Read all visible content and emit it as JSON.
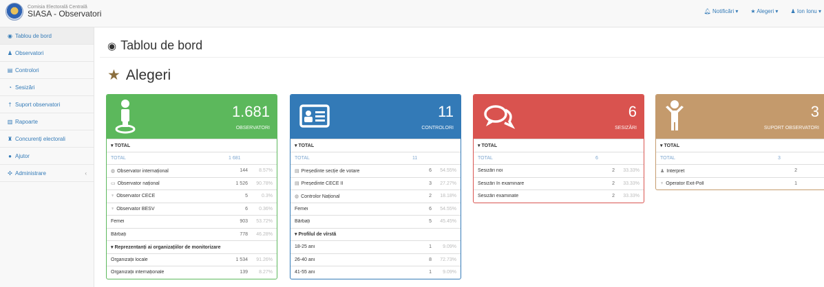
{
  "brand": {
    "sub": "Comisia Electorală Centrală",
    "main": "SIASA - Observatori"
  },
  "topnav": [
    {
      "label": "Notificări ▾",
      "icon": "bell-icon"
    },
    {
      "label": "★ Alegeri ▾",
      "icon": "star-icon"
    },
    {
      "label": "Ion Ionu ▾",
      "icon": "user-icon"
    }
  ],
  "sidebar": [
    {
      "label": "Tablou de bord",
      "glyph": "◉"
    },
    {
      "label": "Observatori",
      "glyph": "♟"
    },
    {
      "label": "Controlori",
      "glyph": "▤"
    },
    {
      "label": "Sesizări",
      "glyph": "◔"
    },
    {
      "label": "Suport observatori",
      "glyph": "†"
    },
    {
      "label": "Rapoarte",
      "glyph": "▥"
    },
    {
      "label": "Concurenți electorali",
      "glyph": "♜"
    },
    {
      "label": "Ajutor",
      "glyph": "●"
    },
    {
      "label": "Administrare",
      "glyph": "✣",
      "arrow": "‹"
    }
  ],
  "page_title": "Tablou de bord",
  "section_title": "Alegeri",
  "colors": {
    "green": "#5cb85c",
    "blue": "#337ab7",
    "red": "#d9534f",
    "tan": "#c49a6c"
  },
  "panels": {
    "observatori": {
      "count": "1.681",
      "label": "OBSERVATORI",
      "rows": [
        {
          "type": "hdr",
          "label": "▾ TOTAL"
        },
        {
          "type": "total",
          "label": "TOTAL",
          "n": "1 681",
          "p": ""
        },
        {
          "label": "Observator internațional",
          "glyph": "◍",
          "n": "144",
          "p": "8.57%"
        },
        {
          "label": "Observator național",
          "glyph": "▭",
          "n": "1 526",
          "p": "90.78%"
        },
        {
          "label": "Observator CECE",
          "glyph": "♆",
          "n": "5",
          "p": "0.3%"
        },
        {
          "label": "Observator BESV",
          "glyph": "♆",
          "n": "6",
          "p": "0.36%"
        },
        {
          "label": "Femei",
          "n": "903",
          "p": "53.72%"
        },
        {
          "label": "Bărbați",
          "n": "778",
          "p": "46.28%"
        },
        {
          "type": "hdr",
          "label": "▾ Reprezentanți ai organizațiilor de monitorizare"
        },
        {
          "label": "Organizații locale",
          "n": "1 534",
          "p": "91.26%"
        },
        {
          "label": "Organizații internaționale",
          "n": "139",
          "p": "8.27%"
        }
      ]
    },
    "controlori": {
      "count": "11",
      "label": "CONTROLORI",
      "rows": [
        {
          "type": "hdr",
          "label": "▾ TOTAL"
        },
        {
          "type": "total",
          "label": "TOTAL",
          "n": "11",
          "p": ""
        },
        {
          "label": "Președinte secție de votare",
          "glyph": "▤",
          "n": "6",
          "p": "54.55%"
        },
        {
          "label": "Președinte CECE II",
          "glyph": "▤",
          "n": "3",
          "p": "27.27%"
        },
        {
          "label": "Controlor Național",
          "glyph": "◍",
          "n": "2",
          "p": "18.18%"
        },
        {
          "label": "Femei",
          "n": "6",
          "p": "54.55%"
        },
        {
          "label": "Bărbați",
          "n": "5",
          "p": "45.45%"
        },
        {
          "type": "hdr",
          "label": "▾ Profilul de vîrstă"
        },
        {
          "label": "18-25 ani",
          "n": "1",
          "p": "9.09%"
        },
        {
          "label": "26-40 ani",
          "n": "8",
          "p": "72.73%"
        },
        {
          "label": "41-55 ani",
          "n": "1",
          "p": "9.09%"
        }
      ]
    },
    "sesizari": {
      "count": "6",
      "label": "SESIZĂRI",
      "rows": [
        {
          "type": "hdr",
          "label": "▾ TOTAL"
        },
        {
          "type": "total",
          "label": "TOTAL",
          "n": "6",
          "p": ""
        },
        {
          "label": "Sesizări noi",
          "n": "2",
          "p": "33.33%"
        },
        {
          "label": "Sesizări în examinare",
          "n": "2",
          "p": "33.33%"
        },
        {
          "label": "Sesizări examinate",
          "n": "2",
          "p": "33.33%"
        }
      ]
    },
    "suport": {
      "count": "3",
      "label": "SUPORT OBSERVATORI",
      "rows": [
        {
          "type": "hdr",
          "label": "▾ TOTAL"
        },
        {
          "type": "total",
          "label": "TOTAL",
          "n": "3",
          "p": ""
        },
        {
          "label": "Interpret",
          "glyph": "♟",
          "n": "2",
          "p": ""
        },
        {
          "label": "Operator Exit-Poll",
          "glyph": "♆",
          "n": "1",
          "p": ""
        }
      ]
    }
  }
}
